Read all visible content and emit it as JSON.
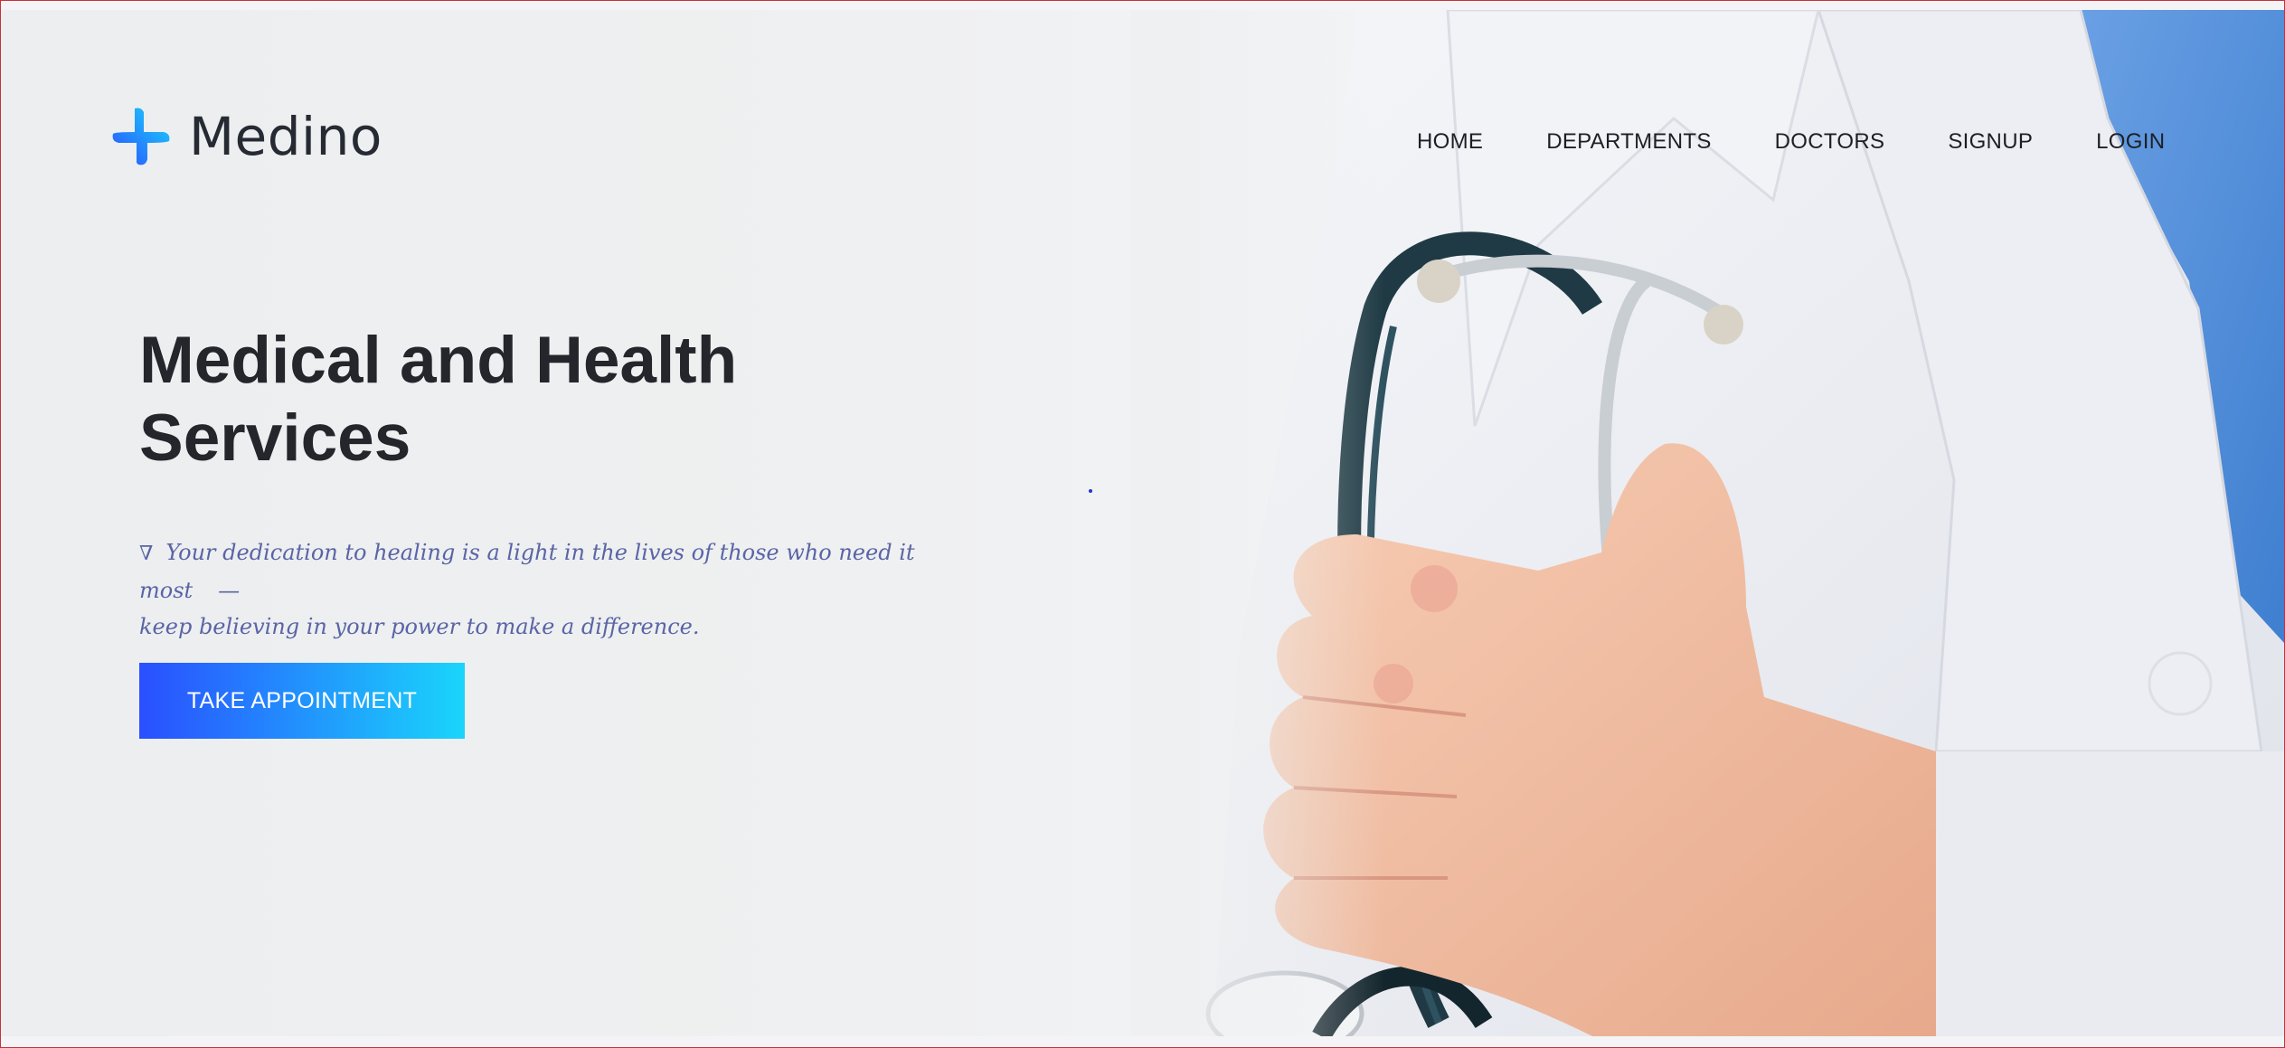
{
  "brand": {
    "name": "Medino",
    "icon": "medical-cross-icon",
    "colors": {
      "start": "#2a4fff",
      "end": "#1ad5fb"
    }
  },
  "nav": {
    "items": [
      {
        "label": "HOME"
      },
      {
        "label": "DEPARTMENTS"
      },
      {
        "label": "DOCTORS"
      },
      {
        "label": "SIGNUP"
      },
      {
        "label": "LOGIN"
      }
    ]
  },
  "hero": {
    "title_line1": "Medical and Health",
    "title_line2": "Services",
    "quote_open": "∇",
    "quote_line1": "Your dedication to healing is a light in the lives of those who need it most",
    "quote_dash": "—",
    "quote_line2": "keep believing in your power to make a difference.",
    "cta_label": "TAKE APPOINTMENT"
  }
}
